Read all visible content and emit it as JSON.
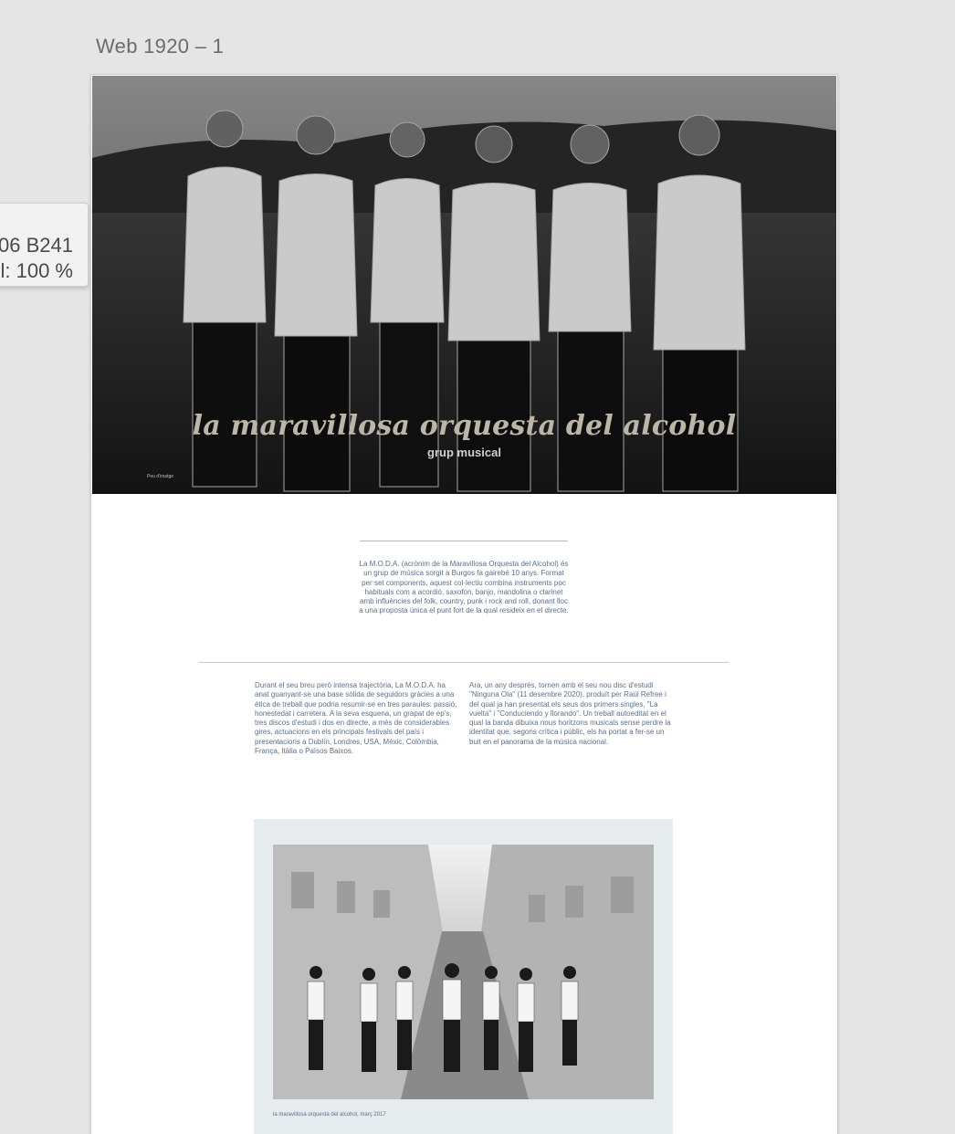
{
  "artboard": {
    "label": "Web 1920 – 1"
  },
  "tooltip": {
    "line1": "06 B241",
    "line2": "l: 100 %"
  },
  "hero": {
    "title": "la maravillosa orquesta del alcohol",
    "subtitle": "grup musical",
    "caption": "Peu d'imatge"
  },
  "intro": {
    "text": "La M.O.D.A. (acrònim de la Maravillosa Orquesta del Alcohol) és un grup de música sorgit a Burgos fa gairebé 10 anys. Format per set components, aquest col·lectiu combina instruments poc habituals com a acordió, saxofon, banjo, mandolina o clarinet amb influències del folk, country, punk i rock and roll, donant lloc a una proposta única el punt fort de la qual resideix en el directe."
  },
  "columns": {
    "left": "Durant el seu breu però intensa trajectòria, La M.O.D.A. ha anat guanyant-se una base sòlida de seguidors gràcies a una ètica de treball que podria resumir-se en tres paraules: passió, honestedat i carretera. A la seva esquena, un grapat de ep's, tres discos d'estudi i dos en directe, a més de considerables gires, actuacions en els principals festivals del país i presentacions a Dublín, Londres, USA, Mèxic, Colòmbia, França, Itàlia o Països Baixos.",
    "right": "Ara, un any després, tornen amb el seu nou disc d'estudi \"Ninguna Ola\" (11 desembre 2020), produït per Raül Refree i del qual ja han presentat els seus dos primers singles, \"La vuelta\" i \"Conduciendo y llorando\". Un treball autoeditat en el qual la banda dibuixa nous horitzons musicals sense perdre la identitat que, segons crítica i públic, els ha portat a fer-se un buit en el panorama de la música nacional."
  },
  "photo": {
    "caption": "la maravillosa orquesta del alcohol, març 2017"
  }
}
